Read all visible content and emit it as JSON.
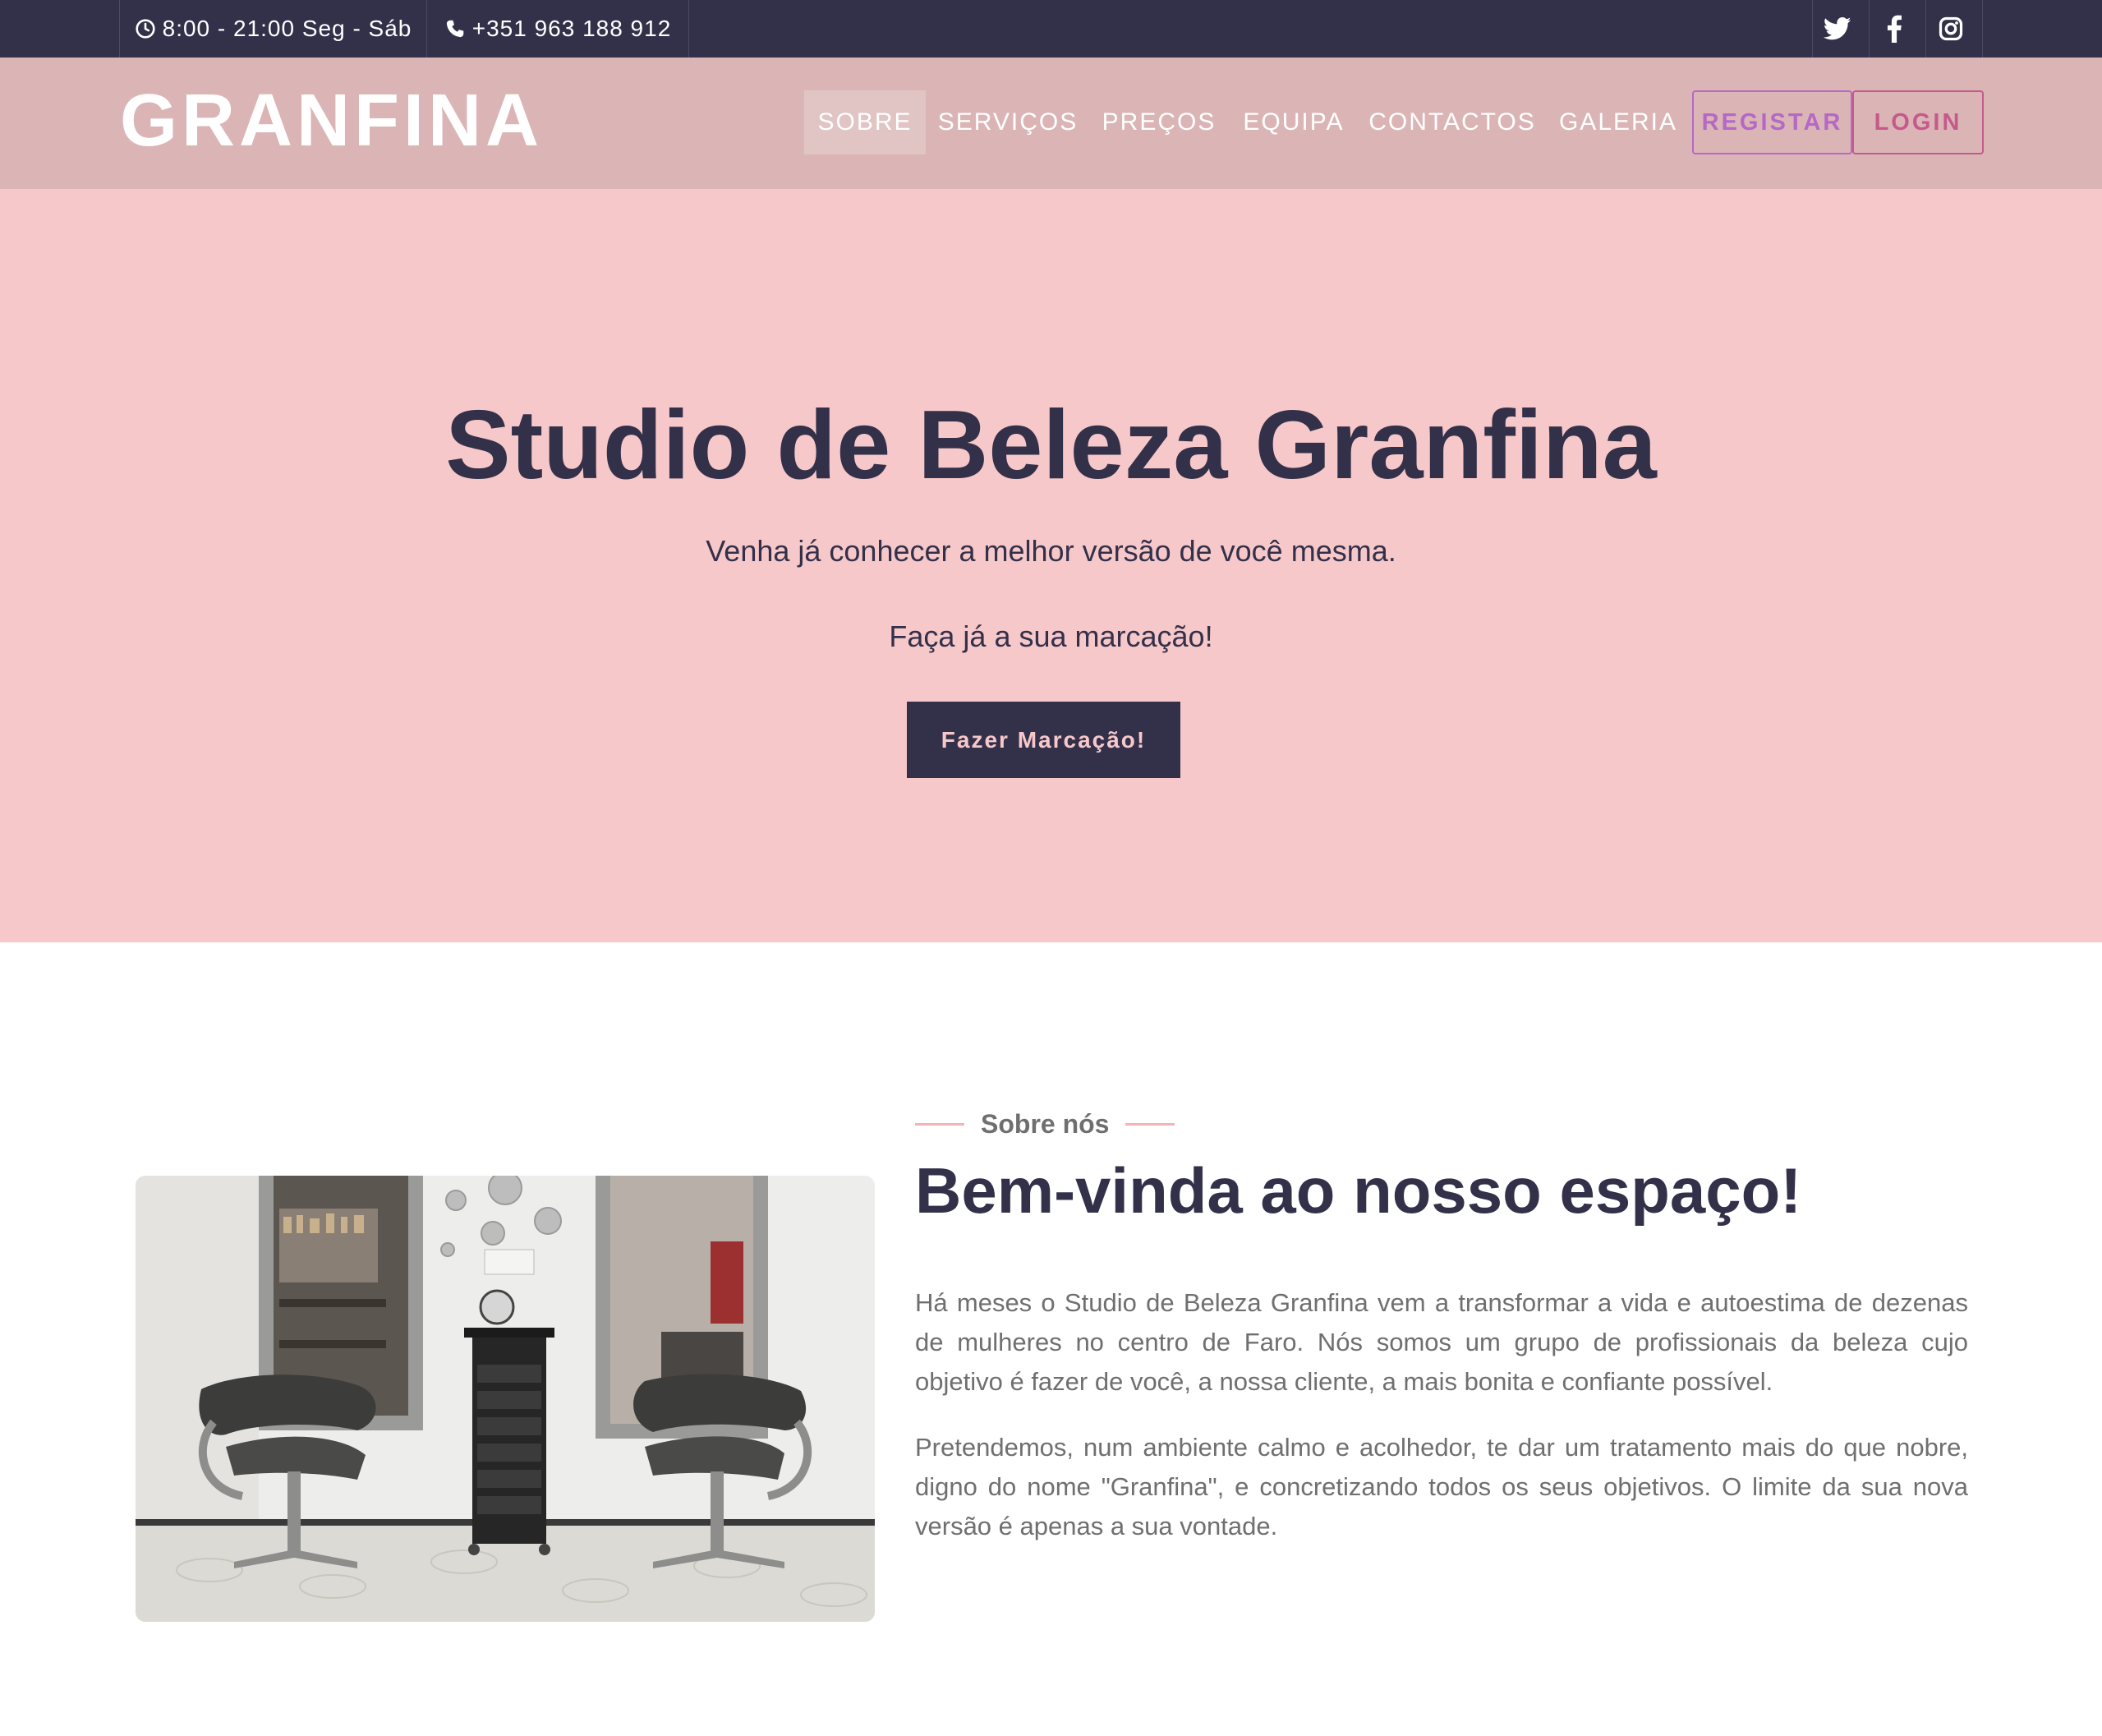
{
  "topbar": {
    "hours": "8:00 - 21:00 Seg - Sáb",
    "phone": "+351 963 188 912",
    "social": [
      "twitter-icon",
      "facebook-icon",
      "instagram-icon"
    ]
  },
  "navbar": {
    "logo": "GRANFINA",
    "items": [
      {
        "label": "SOBRE",
        "active": true
      },
      {
        "label": "SERVIÇOS",
        "active": false
      },
      {
        "label": "PREÇOS",
        "active": false
      },
      {
        "label": "EQUIPA",
        "active": false
      },
      {
        "label": "CONTACTOS",
        "active": false
      },
      {
        "label": "GALERIA",
        "active": false
      }
    ],
    "register_label": "REGISTAR",
    "login_label": "LOGIN"
  },
  "hero": {
    "title": "Studio de Beleza Granfina",
    "subtitle": "Venha já conhecer a melhor versão de você mesma.",
    "subtitle2": "Faça já a sua marcação!",
    "cta_label": "Fazer Marcação!"
  },
  "about": {
    "kicker": "Sobre nós",
    "title": "Bem-vinda ao nosso espaço!",
    "paragraph1": "Há meses o Studio de Beleza Granfina vem a transformar a vida e autoestima de dezenas de mulheres no centro de Faro. Nós somos um grupo de profissionais da beleza cujo objetivo é fazer de você, a nossa cliente, a mais bonita e confiante possível.",
    "paragraph2": "Pretendemos, num ambiente calmo e acolhedor, te dar um tratamento mais do que nobre, digno do nome \"Granfina\", e concretizando todos os seus objetivos. O limite da sua nova versão é apenas a sua vontade."
  },
  "colors": {
    "dark": "#33304a",
    "navbar_bg": "#dbb5b6",
    "hero_bg": "#f7c8c9",
    "register_accent": "#b568c6",
    "login_accent": "#c55a8a",
    "kicker_line": "#f2b4b6"
  }
}
